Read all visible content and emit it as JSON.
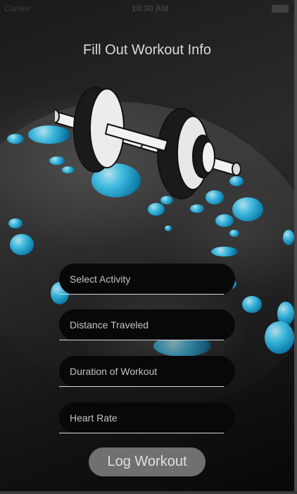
{
  "status_bar": {
    "carrier": "Carrier",
    "time": "10:30 AM"
  },
  "page": {
    "title": "Fill Out Workout Info"
  },
  "illustration": {
    "icon": "dumbbell-icon"
  },
  "fields": [
    {
      "placeholder": "Select Activity"
    },
    {
      "placeholder": "Distance Traveled"
    },
    {
      "placeholder": "Duration of Workout"
    },
    {
      "placeholder": "Heart Rate"
    }
  ],
  "actions": {
    "log_workout_label": "Log Workout"
  },
  "colors": {
    "accent_water": "#3fc7f0",
    "field_bg": "#080808",
    "button_bg": "#707070"
  }
}
